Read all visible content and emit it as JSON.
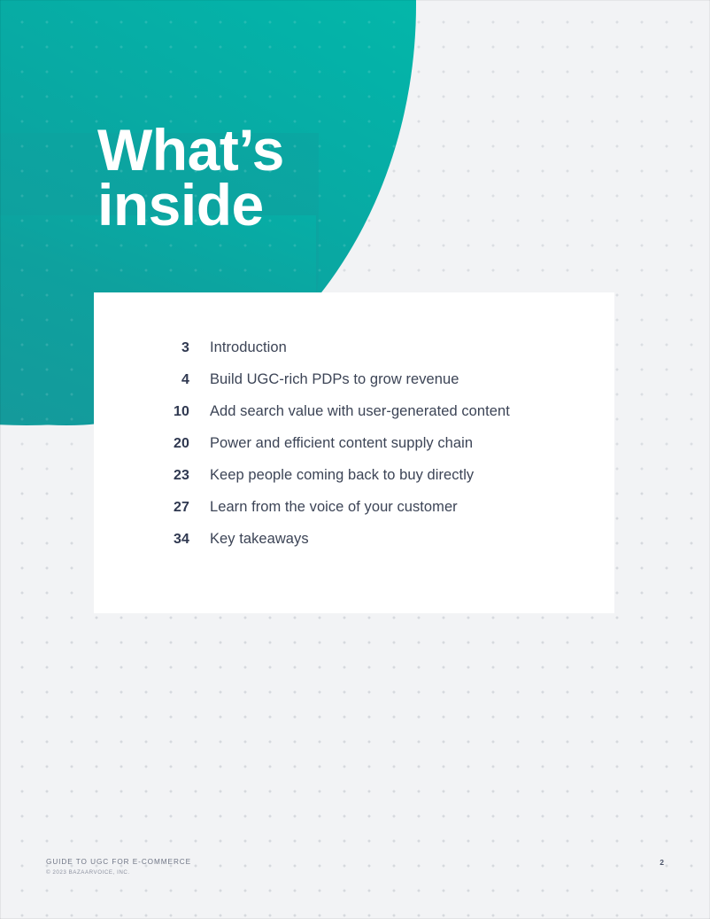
{
  "document": {
    "page_background": "#f2f3f5",
    "accent_teal_light": "#02c7b0",
    "accent_teal_dark": "#159699",
    "text_color": "#3c4456"
  },
  "hero": {
    "title": "What’s\ninside",
    "title_color": "#ffffff"
  },
  "toc": {
    "card_background": "#ffffff",
    "entries": [
      {
        "page": "3",
        "label": "Introduction"
      },
      {
        "page": "4",
        "label": "Build UGC-rich PDPs to grow revenue"
      },
      {
        "page": "10",
        "label": "Add search value with user-generated content"
      },
      {
        "page": "20",
        "label": "Power and efficient content supply chain"
      },
      {
        "page": "23",
        "label": "Keep people coming back to buy directly"
      },
      {
        "page": "27",
        "label": "Learn from the voice of your customer"
      },
      {
        "page": "34",
        "label": "Key takeaways"
      }
    ]
  },
  "footer": {
    "document_title": "GUIDE TO UGC FOR E-COMMERCE",
    "copyright": "© 2023 BAZAARVOICE, INC.",
    "page_number": "2"
  }
}
